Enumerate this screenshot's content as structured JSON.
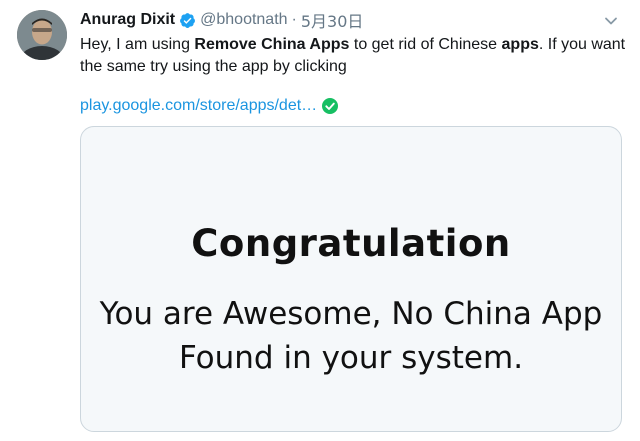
{
  "tweet": {
    "author_name": "Anurag Dixit",
    "handle": "@bhootnath",
    "separator": "·",
    "date": "5月30日",
    "text_parts": [
      "Hey, I am using ",
      "Remove China Apps",
      " to get rid of Chinese ",
      "apps",
      ". If you want the same try using the app by clicking"
    ],
    "link": "play.google.com/store/apps/det…",
    "card": {
      "title": "Congratulation",
      "body_line1": "You are Awesome, No China App",
      "body_line2": "Found in your system."
    }
  },
  "colors": {
    "link": "#1b95e0",
    "verified": "#1da1f2",
    "check": "#17bf63",
    "secondary_text": "#657786"
  },
  "icons": [
    "avatar",
    "verified-badge-icon",
    "chevron-down-icon",
    "check-circle-icon"
  ]
}
